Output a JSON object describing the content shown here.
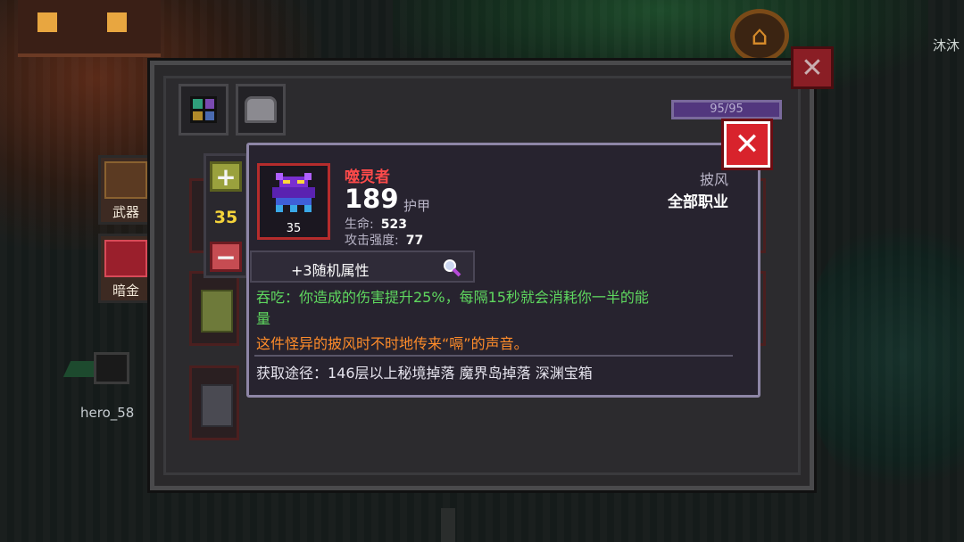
{
  "background": {
    "npc_name": "沐沐",
    "hero_name": "hero_58",
    "side_buttons": [
      {
        "label": "武器",
        "icon": "weapon-shop-icon"
      },
      {
        "label": "暗金",
        "icon": "dark-gold-icon"
      }
    ]
  },
  "window": {
    "tabs": [
      {
        "icon": "inventory-grid-icon"
      },
      {
        "icon": "armor-icon"
      }
    ],
    "hp": "95/95",
    "close_icon": "close-icon"
  },
  "stepper": {
    "value": "35",
    "plus_label": "+",
    "minus_label": "−"
  },
  "item": {
    "name": "噬灵者",
    "armor_value": "189",
    "armor_label": "护甲",
    "level": "35",
    "stats": [
      {
        "label": "生命:",
        "value": "523"
      },
      {
        "label": "攻击强度:",
        "value": "77"
      }
    ],
    "type": "披风",
    "class": "全部职业",
    "random_attr": "+3随机属性",
    "desc_lines": [
      "吞吃：你造成的伤害提升25%，每隔15秒就会消耗你一半的能",
      "量"
    ],
    "flavor": "这件怪异的披风时不时地传来“嗝”的声音。",
    "source": "获取途径：146层以上秘境掉落 魔界岛掉落 深渊宝箱",
    "close_label": "✕",
    "colors": {
      "name": "#ff4a4a",
      "desc": "#5fd85f",
      "flavor": "#ff8c2a",
      "frame": "#b52c2c"
    }
  }
}
